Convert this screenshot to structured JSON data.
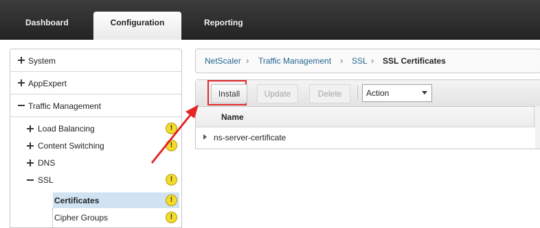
{
  "nav": {
    "tabs": [
      "Dashboard",
      "Configuration",
      "Reporting"
    ],
    "active_tab": "Configuration"
  },
  "tree": {
    "sections": [
      {
        "label": "System",
        "expanded": false
      },
      {
        "label": "AppExpert",
        "expanded": false
      },
      {
        "label": "Traffic Management",
        "expanded": true
      }
    ],
    "children": [
      {
        "label": "Load Balancing",
        "toggle": "+",
        "warning": "!"
      },
      {
        "label": "Content Switching",
        "toggle": "+",
        "warning": "!"
      },
      {
        "label": "DNS",
        "toggle": "+",
        "warning": ""
      },
      {
        "label": "SSL",
        "toggle": "−",
        "warning": "!"
      }
    ],
    "ssl_children": [
      {
        "label": "Certificates",
        "selected": true,
        "warning": "!"
      },
      {
        "label": "Cipher Groups",
        "selected": false,
        "warning": "!"
      }
    ]
  },
  "breadcrumb": {
    "items": [
      "NetScaler",
      "Traffic Management",
      "SSL"
    ],
    "current": "SSL Certificates"
  },
  "toolbar": {
    "install_label": "Install",
    "update_label": "Update",
    "delete_label": "Delete",
    "action_select": "Action"
  },
  "table": {
    "columns": [
      "Name"
    ],
    "rows": [
      {
        "name": "ns-server-certificate"
      }
    ]
  },
  "colors": {
    "topbar": "#2d2d2d",
    "link": "#24658f",
    "selection": "#cfe3f3",
    "highlight": "#e32626",
    "warning": "#f3dc2c"
  }
}
